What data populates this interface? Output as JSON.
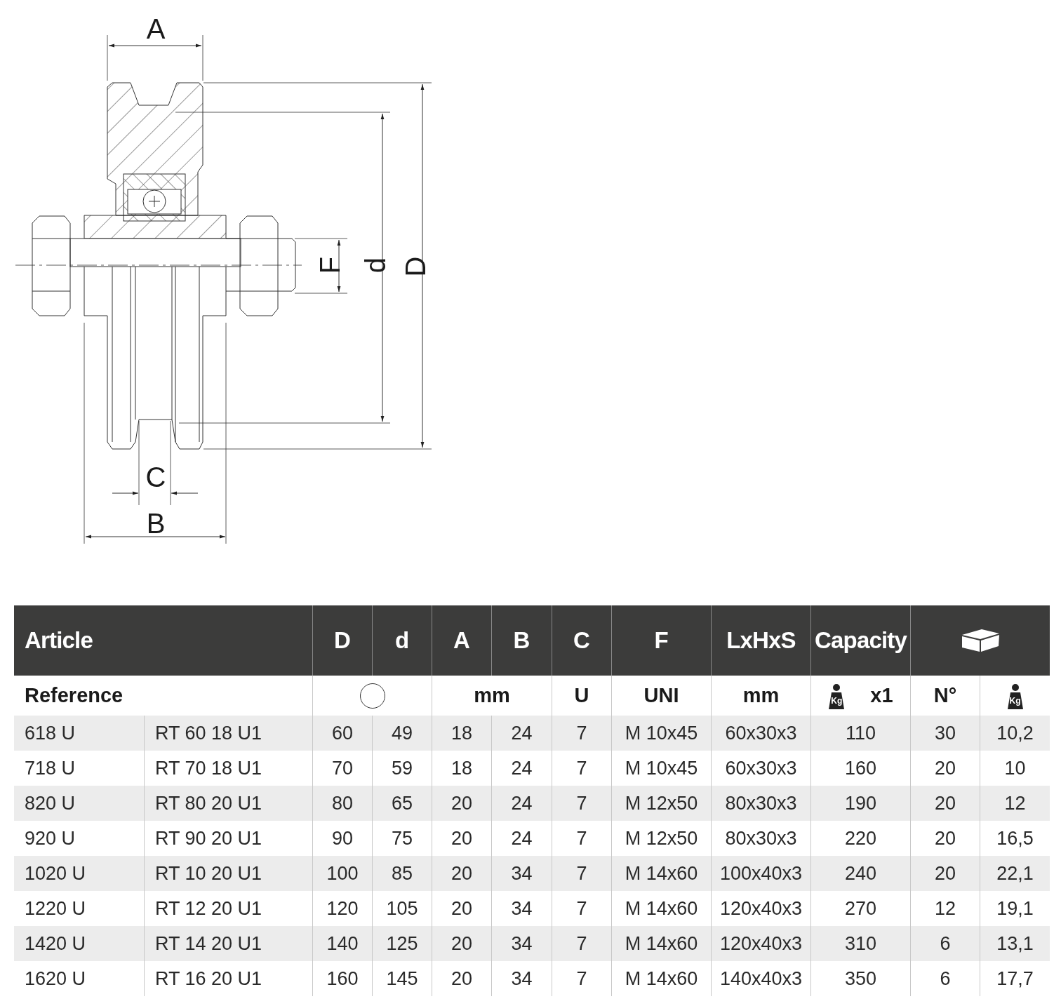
{
  "drawing": {
    "labels": [
      {
        "text": "A"
      },
      {
        "text": "D"
      },
      {
        "text": "d"
      },
      {
        "text": "F"
      },
      {
        "text": "C"
      },
      {
        "text": "B"
      }
    ]
  },
  "table": {
    "heading_band": [
      {
        "kind": "text",
        "label": "Article"
      },
      {
        "kind": "text",
        "label": "D"
      },
      {
        "kind": "text",
        "label": "d"
      },
      {
        "kind": "text",
        "label": "A"
      },
      {
        "kind": "text",
        "label": "B"
      },
      {
        "kind": "text",
        "label": "C"
      },
      {
        "kind": "text",
        "label": "F"
      },
      {
        "kind": "text",
        "label": "LxHxS"
      },
      {
        "kind": "text",
        "label": "Capacity"
      },
      {
        "kind": "box-icon"
      }
    ],
    "unit_band": [
      {
        "kind": "text",
        "label": "Reference"
      },
      {
        "kind": "circle-icon"
      },
      {
        "kind": "text",
        "label": "mm"
      },
      {
        "kind": "text",
        "label": "U"
      },
      {
        "kind": "text",
        "label": "UNI"
      },
      {
        "kind": "text",
        "label": "mm"
      },
      {
        "kind": "weight",
        "weight_label": "Kg",
        "label": "x1"
      },
      {
        "kind": "text",
        "label": "N°"
      },
      {
        "kind": "weight",
        "weight_label": "Kg"
      }
    ],
    "rows": [
      [
        "618 U",
        "RT 60 18 U1",
        "60",
        "49",
        "18",
        "24",
        "7",
        "M 10x45",
        "60x30x3",
        "110",
        "30",
        "10,2"
      ],
      [
        "718 U",
        "RT 70 18 U1",
        "70",
        "59",
        "18",
        "24",
        "7",
        "M 10x45",
        "60x30x3",
        "160",
        "20",
        "10"
      ],
      [
        "820 U",
        "RT 80 20 U1",
        "80",
        "65",
        "20",
        "24",
        "7",
        "M 12x50",
        "80x30x3",
        "190",
        "20",
        "12"
      ],
      [
        "920 U",
        "RT 90 20 U1",
        "90",
        "75",
        "20",
        "24",
        "7",
        "M 12x50",
        "80x30x3",
        "220",
        "20",
        "16,5"
      ],
      [
        "1020 U",
        "RT 10 20 U1",
        "100",
        "85",
        "20",
        "34",
        "7",
        "M 14x60",
        "100x40x3",
        "240",
        "20",
        "22,1"
      ],
      [
        "1220 U",
        "RT 12 20 U1",
        "120",
        "105",
        "20",
        "34",
        "7",
        "M 14x60",
        "120x40x3",
        "270",
        "12",
        "19,1"
      ],
      [
        "1420 U",
        "RT 14 20 U1",
        "140",
        "125",
        "20",
        "34",
        "7",
        "M 14x60",
        "120x40x3",
        "310",
        "6",
        "13,1"
      ],
      [
        "1620 U",
        "RT 16 20 U1",
        "160",
        "145",
        "20",
        "34",
        "7",
        "M 14x60",
        "140x40x3",
        "350",
        "6",
        "17,7"
      ]
    ]
  }
}
